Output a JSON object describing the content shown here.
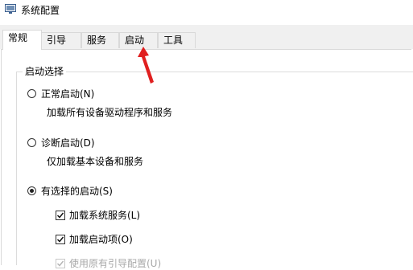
{
  "window": {
    "title": "系统配置"
  },
  "tabs": [
    {
      "label": "常规",
      "active": true
    },
    {
      "label": "引导",
      "active": false
    },
    {
      "label": "服务",
      "active": false
    },
    {
      "label": "启动",
      "active": false
    },
    {
      "label": "工具",
      "active": false
    }
  ],
  "startup_selection": {
    "group_title": "启动选择",
    "options": [
      {
        "label": "正常启动(N)",
        "description": "加载所有设备驱动程序和服务",
        "selected": false
      },
      {
        "label": "诊断启动(D)",
        "description": "仅加载基本设备和服务",
        "selected": false
      },
      {
        "label": "有选择的启动(S)",
        "selected": true
      }
    ],
    "selective_items": [
      {
        "label": "加载系统服务(L)",
        "checked": true,
        "enabled": true
      },
      {
        "label": "加载启动项(O)",
        "checked": true,
        "enabled": true
      },
      {
        "label": "使用原有引导配置(U)",
        "checked": true,
        "enabled": false
      }
    ]
  },
  "annotation": {
    "arrow_color": "#e02020"
  }
}
